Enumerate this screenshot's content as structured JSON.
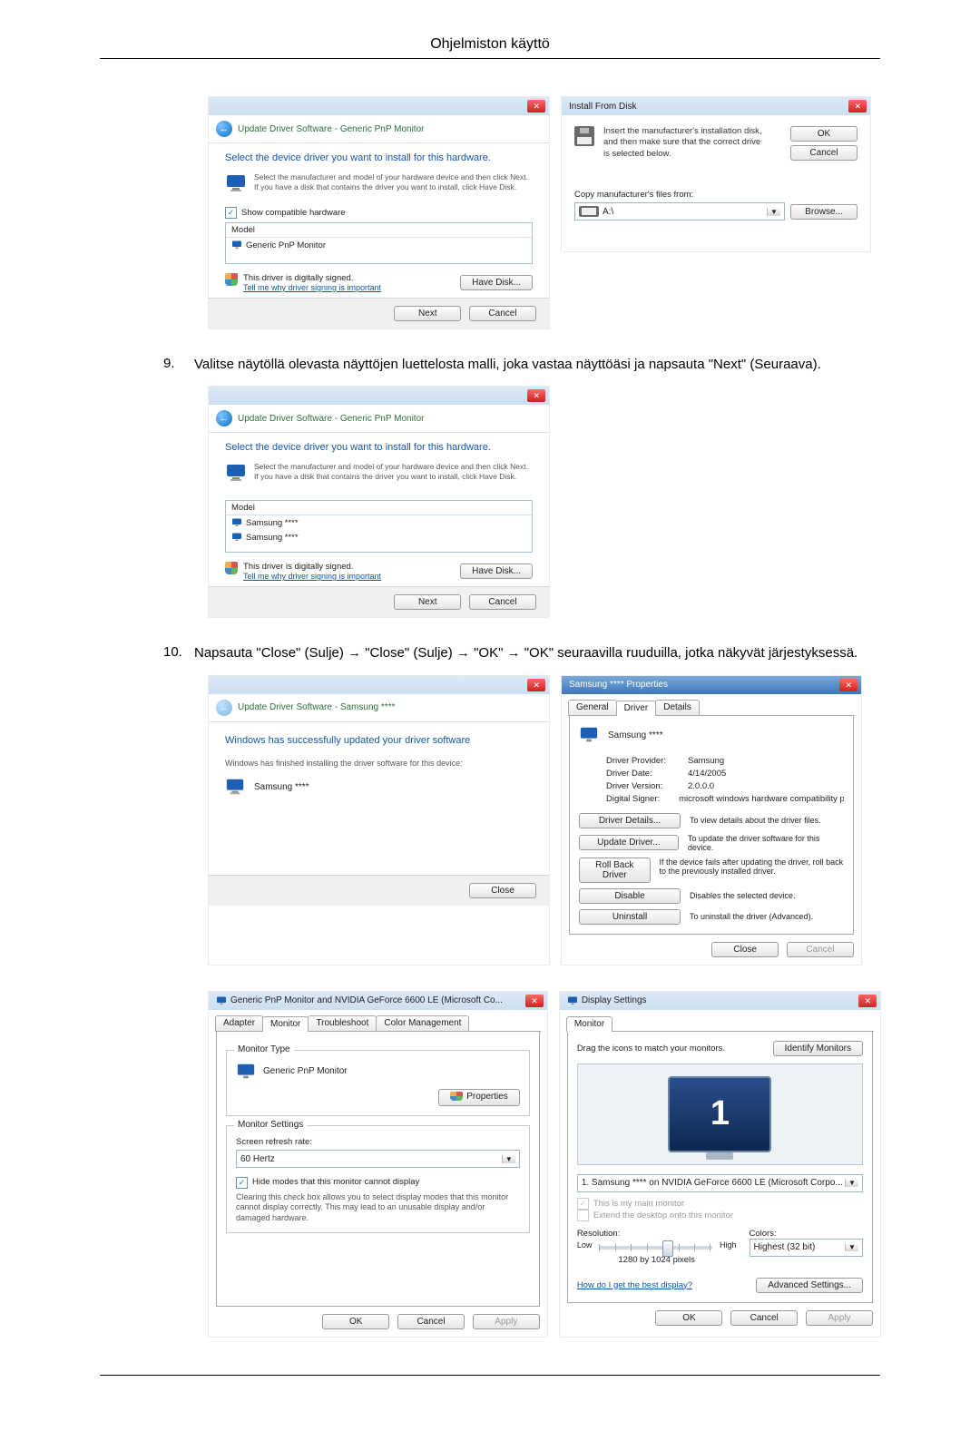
{
  "page": {
    "header": "Ohjelmiston käyttö"
  },
  "wiz1": {
    "crumb": "Update Driver Software - Generic PnP Monitor",
    "heading": "Select the device driver you want to install for this hardware.",
    "intro": "Select the manufacturer and model of your hardware device and then click Next. If you have a disk that contains the driver you want to install, click Have Disk.",
    "compat_checkbox": "Show compatible hardware",
    "model_hdr": "Model",
    "model_item": "Generic PnP Monitor",
    "signed": "This driver is digitally signed.",
    "signed_link": "Tell me why driver signing is important",
    "have_disk": "Have Disk...",
    "next": "Next",
    "cancel": "Cancel"
  },
  "install_disk": {
    "title": "Install From Disk",
    "msg": "Insert the manufacturer's installation disk, and then make sure that the correct drive is selected below.",
    "ok": "OK",
    "cancel": "Cancel",
    "copy_label": "Copy manufacturer's files from:",
    "path": "A:\\",
    "browse": "Browse..."
  },
  "step9": {
    "num": "9.",
    "text": "Valitse näytöllä olevasta näyttöjen luettelosta malli, joka vastaa näyttöäsi ja napsauta \"Next\" (Seuraava)."
  },
  "wiz2": {
    "crumb": "Update Driver Software - Generic PnP Monitor",
    "heading": "Select the device driver you want to install for this hardware.",
    "intro": "Select the manufacturer and model of your hardware device and then click Next. If you have a disk that contains the driver you want to install, click Have Disk.",
    "model_hdr": "Model",
    "model_item1": "Samsung ****",
    "model_item2": "Samsung ****",
    "signed": "This driver is digitally signed.",
    "signed_link": "Tell me why driver signing is important",
    "have_disk": "Have Disk...",
    "next": "Next",
    "cancel": "Cancel"
  },
  "step10": {
    "num": "10.",
    "text": "Napsauta \"Close\" (Sulje) → \"Close\" (Sulje) → \"OK\" → \"OK\" seuraavilla ruuduilla, jotka näkyvät järjestyksessä."
  },
  "wiz_done": {
    "crumb": "Update Driver Software - Samsung ****",
    "heading": "Windows has successfully updated your driver software",
    "sub": "Windows has finished installing the driver software for this device:",
    "device": "Samsung ****",
    "close": "Close"
  },
  "props": {
    "title": "Samsung **** Properties",
    "tab_general": "General",
    "tab_driver": "Driver",
    "tab_details": "Details",
    "device": "Samsung ****",
    "row_provider_l": "Driver Provider:",
    "row_provider_v": "Samsung",
    "row_date_l": "Driver Date:",
    "row_date_v": "4/14/2005",
    "row_version_l": "Driver Version:",
    "row_version_v": "2.0.0.0",
    "row_signer_l": "Digital Signer:",
    "row_signer_v": "microsoft windows hardware compatibility publisl",
    "btn_details": "Driver Details...",
    "btn_details_d": "To view details about the driver files.",
    "btn_update": "Update Driver...",
    "btn_update_d": "To update the driver software for this device.",
    "btn_rollback": "Roll Back Driver",
    "btn_rollback_d": "If the device fails after updating the driver, roll back to the previously installed driver.",
    "btn_disable": "Disable",
    "btn_disable_d": "Disables the selected device.",
    "btn_uninstall": "Uninstall",
    "btn_uninstall_d": "To uninstall the driver (Advanced).",
    "close": "Close",
    "cancel": "Cancel"
  },
  "adapter": {
    "title": "Generic PnP Monitor and NVIDIA GeForce 6600 LE (Microsoft Co...",
    "tab_adapter": "Adapter",
    "tab_monitor": "Monitor",
    "tab_trouble": "Troubleshoot",
    "tab_color": "Color Management",
    "grp_type": "Monitor Type",
    "type_val": "Generic PnP Monitor",
    "properties": "Properties",
    "grp_settings": "Monitor Settings",
    "refresh_label": "Screen refresh rate:",
    "refresh_val": "60 Hertz",
    "hide_chk": "Hide modes that this monitor cannot display",
    "hide_desc": "Clearing this check box allows you to select display modes that this monitor cannot display correctly. This may lead to an unusable display and/or damaged hardware.",
    "ok": "OK",
    "cancel": "Cancel",
    "apply": "Apply"
  },
  "dispsettings": {
    "title": "Display Settings",
    "tab_monitor": "Monitor",
    "drag": "Drag the icons to match your monitors.",
    "identify": "Identify Monitors",
    "monitor_num": "1",
    "combo": "1. Samsung **** on NVIDIA GeForce 6600 LE (Microsoft Corpo...",
    "main_chk": "This is my main monitor",
    "extend_chk": "Extend the desktop onto this monitor",
    "res_label": "Resolution:",
    "low": "Low",
    "high": "High",
    "res_val": "1280 by 1024 pixels",
    "colors_label": "Colors:",
    "colors_val": "Highest (32 bit)",
    "help_link": "How do I get the best display?",
    "advanced": "Advanced Settings...",
    "ok": "OK",
    "cancel": "Cancel",
    "apply": "Apply"
  }
}
